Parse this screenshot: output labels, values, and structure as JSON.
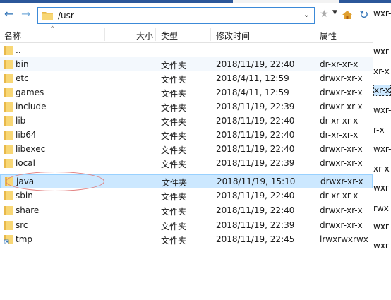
{
  "address": {
    "path": "/usr"
  },
  "columns": {
    "name": "名称",
    "size": "大小",
    "type": "类型",
    "modified": "修改时间",
    "perms": "属性"
  },
  "rows": [
    {
      "name": "..",
      "type": "",
      "modified": "",
      "perms": "",
      "icon": "folder-icon"
    },
    {
      "name": "bin",
      "type": "文件夹",
      "modified": "2018/11/19, 22:40",
      "perms": "dr-xr-xr-x",
      "icon": "folder-icon"
    },
    {
      "name": "etc",
      "type": "文件夹",
      "modified": "2018/4/11, 12:59",
      "perms": "drwxr-xr-x",
      "icon": "folder-icon"
    },
    {
      "name": "games",
      "type": "文件夹",
      "modified": "2018/4/11, 12:59",
      "perms": "drwxr-xr-x",
      "icon": "folder-icon"
    },
    {
      "name": "include",
      "type": "文件夹",
      "modified": "2018/11/19, 22:39",
      "perms": "drwxr-xr-x",
      "icon": "folder-icon"
    },
    {
      "name": "lib",
      "type": "文件夹",
      "modified": "2018/11/19, 22:40",
      "perms": "dr-xr-xr-x",
      "icon": "folder-icon"
    },
    {
      "name": "lib64",
      "type": "文件夹",
      "modified": "2018/11/19, 22:40",
      "perms": "dr-xr-xr-x",
      "icon": "folder-icon"
    },
    {
      "name": "libexec",
      "type": "文件夹",
      "modified": "2018/11/19, 22:40",
      "perms": "drwxr-xr-x",
      "icon": "folder-icon"
    },
    {
      "name": "local",
      "type": "文件夹",
      "modified": "2018/11/19, 22:39",
      "perms": "drwxr-xr-x",
      "icon": "folder-icon"
    },
    {
      "name": "java",
      "type": "文件夹",
      "modified": "2018/11/19, 15:10",
      "perms": "drwxr-xr-x",
      "icon": "folder-icon",
      "selected": true
    },
    {
      "name": "sbin",
      "type": "文件夹",
      "modified": "2018/11/19, 22:40",
      "perms": "dr-xr-xr-x",
      "icon": "folder-icon"
    },
    {
      "name": "share",
      "type": "文件夹",
      "modified": "2018/11/19, 22:40",
      "perms": "drwxr-xr-x",
      "icon": "folder-icon"
    },
    {
      "name": "src",
      "type": "文件夹",
      "modified": "2018/11/19, 22:39",
      "perms": "drwxr-xr-x",
      "icon": "folder-icon"
    },
    {
      "name": "tmp",
      "type": "文件夹",
      "modified": "2018/11/19, 22:45",
      "perms": "lrwxrwxrwx",
      "icon": "symlink-folder-icon"
    }
  ],
  "right_pane": [
    "wxr-",
    "wxr-",
    "xr-x",
    "xr-x",
    "wxr-",
    "r-x",
    "wxr-",
    "xr-x",
    "wxr-",
    "rwx",
    "wxr-",
    "wxr-"
  ],
  "colors": {
    "selection": "#cce8ff",
    "accent": "#2b579a",
    "folder": "#f8d775"
  }
}
